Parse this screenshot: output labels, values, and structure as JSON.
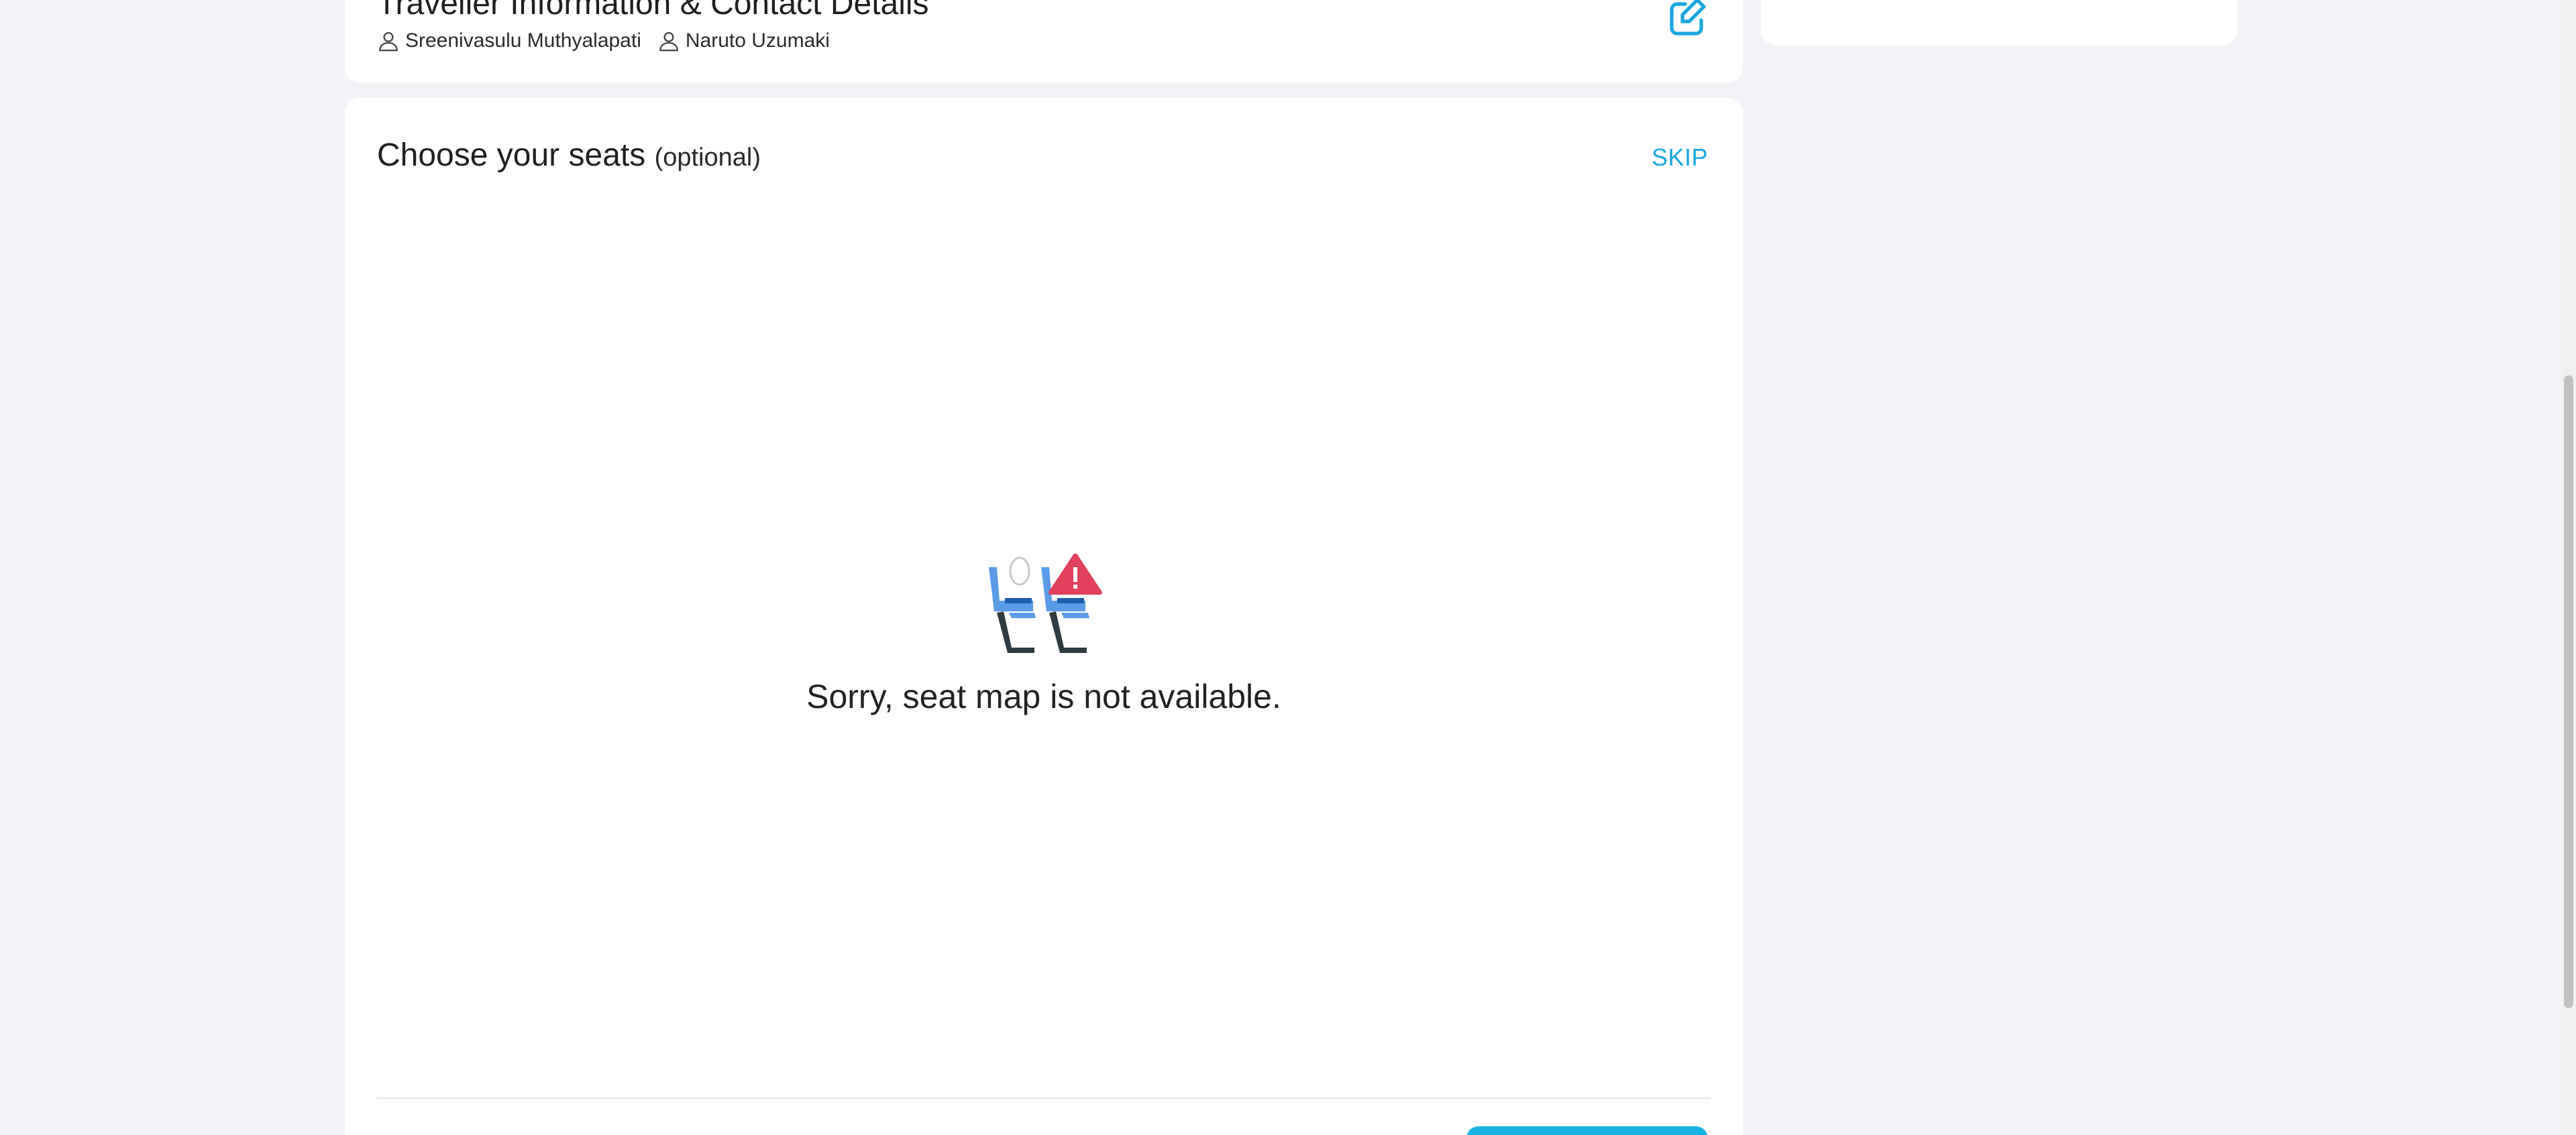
{
  "traveller_section": {
    "title": "Traveller Information & Contact Details",
    "travellers": [
      {
        "name": "Sreenivasulu Muthyalapati",
        "icon": "person-icon"
      },
      {
        "name": "Naruto Uzumaki",
        "icon": "person-icon"
      }
    ],
    "edit_icon": "edit-icon"
  },
  "seats_section": {
    "title": "Choose your seats",
    "optional_label": "(optional)",
    "skip_label": "SKIP",
    "unavailable_icon": "seat-warning-icon",
    "unavailable_message": "Sorry, seat map is not available."
  },
  "colors": {
    "accent": "#1aa7e0",
    "button": "#1bb3e3",
    "warning": "#e0405a",
    "seat_blue": "#5a9be6",
    "background": "#f2f3f7"
  }
}
